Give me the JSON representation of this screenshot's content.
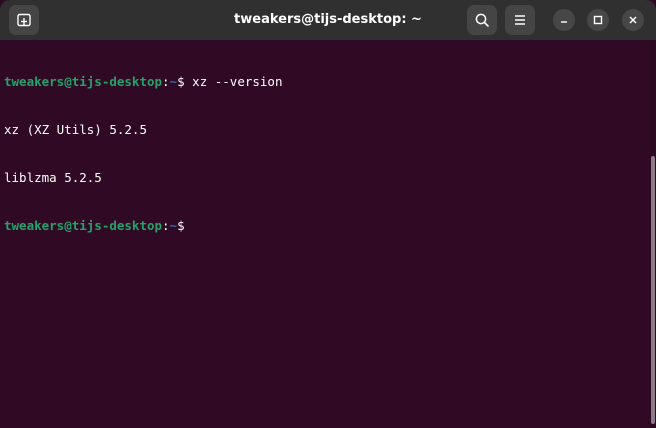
{
  "window": {
    "title": "tweakers@tijs-desktop: ~"
  },
  "titlebar": {
    "new_tab_icon": "new-tab-icon",
    "search_icon": "search-icon",
    "menu_icon": "hamburger-menu-icon",
    "minimize_icon": "minimize-icon",
    "maximize_icon": "maximize-icon",
    "close_icon": "close-icon"
  },
  "terminal": {
    "lines": [
      {
        "user_host": "tweakers@tijs-desktop",
        "sep": ":",
        "path": "~",
        "prompt": "$ ",
        "command": "xz --version"
      },
      {
        "output": "xz (XZ Utils) 5.2.5"
      },
      {
        "output": "liblzma 5.2.5"
      },
      {
        "user_host": "tweakers@tijs-desktop",
        "sep": ":",
        "path": "~",
        "prompt": "$ ",
        "command": ""
      }
    ]
  },
  "colors": {
    "background": "#300a24",
    "titlebar": "#303030",
    "user_host": "#26a269",
    "path": "#3465a4"
  }
}
